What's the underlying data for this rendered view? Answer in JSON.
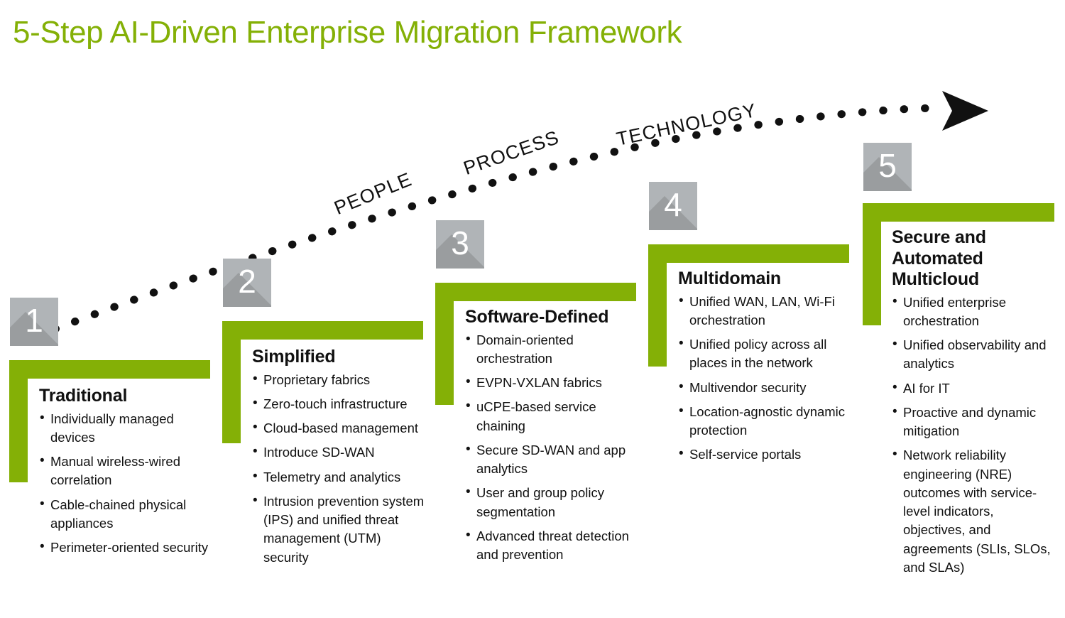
{
  "page": {
    "title": "5-Step AI-Driven Enterprise Migration Framework",
    "accent_color": "#84b006",
    "number_box_color": "#b0b4b7",
    "number_box_shadow_color": "#9a9d9f",
    "text_color": "#111111",
    "background_color": "#ffffff"
  },
  "arrow": {
    "labels": [
      {
        "text": "PEOPLE",
        "rotation_deg": -22
      },
      {
        "text": "PROCESS",
        "rotation_deg": -19
      },
      {
        "text": "TECHNOLOGY",
        "rotation_deg": -12
      }
    ],
    "style": "dotted-ascending-curve-with-arrowhead"
  },
  "steps": [
    {
      "number": "1",
      "heading": "Traditional",
      "bullets": [
        "Individually managed devices",
        "Manual wireless-wired correlation",
        "Cable-chained physical appliances",
        "Perimeter-oriented security"
      ]
    },
    {
      "number": "2",
      "heading": "Simplified",
      "bullets": [
        "Proprietary fabrics",
        "Zero-touch infrastructure",
        "Cloud-based management",
        "Introduce SD-WAN",
        "Telemetry and analytics",
        "Intrusion prevention system (IPS) and unified threat management (UTM) security"
      ]
    },
    {
      "number": "3",
      "heading": "Software-Defined",
      "bullets": [
        "Domain-oriented orchestration",
        "EVPN-VXLAN fabrics",
        "uCPE-based service chaining",
        "Secure SD-WAN and app analytics",
        "User and group policy segmentation",
        "Advanced threat detection and prevention"
      ]
    },
    {
      "number": "4",
      "heading": "Multidomain",
      "bullets": [
        "Unified WAN, LAN, Wi-Fi orchestration",
        "Unified policy across all places in the network",
        "Multivendor security",
        "Location-agnostic dynamic protection",
        "Self-service portals"
      ]
    },
    {
      "number": "5",
      "heading": "Secure and Automated Multicloud",
      "bullets": [
        "Unified enterprise orchestration",
        "Unified observability and analytics",
        "AI for IT",
        "Proactive and dynamic mitigation",
        "Network reliability engineering (NRE) outcomes with service-level indicators, objectives, and agreements (SLIs, SLOs, and SLAs)"
      ]
    }
  ]
}
